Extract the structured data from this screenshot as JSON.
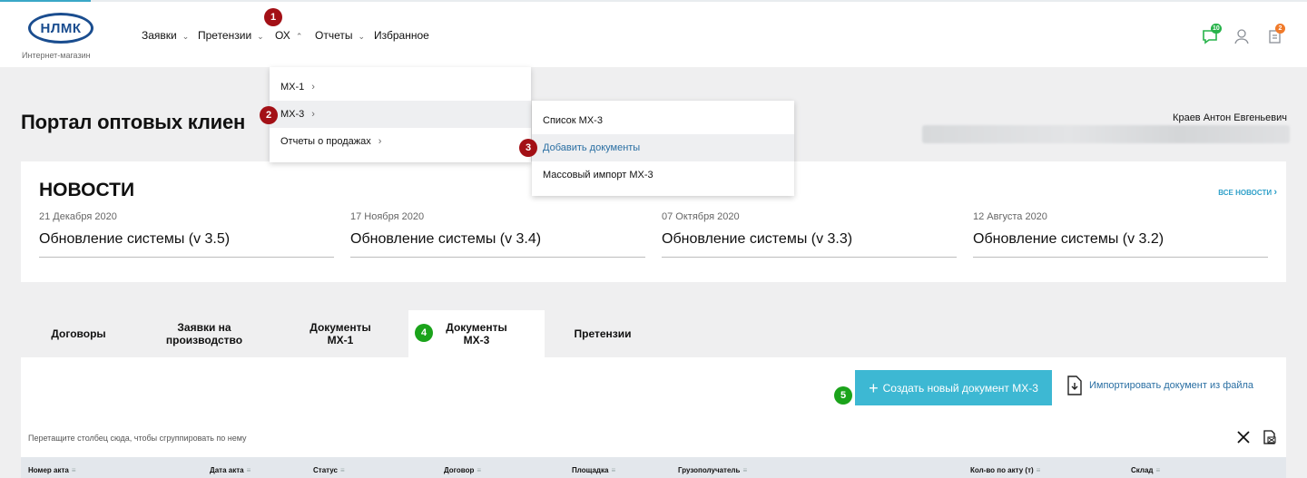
{
  "header": {
    "logo_text": "НЛМК",
    "logo_subtitle": "Интернет-магазин",
    "nav": [
      {
        "label": "Заявки",
        "chevron": "down"
      },
      {
        "label": "Претензии",
        "chevron": "down"
      },
      {
        "label": "ОХ",
        "chevron": "up"
      },
      {
        "label": "Отчеты",
        "chevron": "down"
      },
      {
        "label": "Избранное"
      }
    ],
    "icons": [
      {
        "name": "chat-icon",
        "badge": "10",
        "badge_color": "#27b34a"
      },
      {
        "name": "user-icon"
      },
      {
        "name": "cart-icon",
        "badge": "2",
        "badge_color": "#f07a2a"
      }
    ]
  },
  "menu": {
    "level1": [
      {
        "label": "МХ-1"
      },
      {
        "label": "МХ-3"
      },
      {
        "label": "Отчеты о продажах"
      }
    ],
    "level2": [
      {
        "label": "Список МХ-3"
      },
      {
        "label": "Добавить документы"
      },
      {
        "label": "Массовый импорт МХ-3"
      }
    ]
  },
  "steps": [
    "1",
    "2",
    "3",
    "4",
    "5"
  ],
  "page": {
    "title": "Портал оптовых клиен",
    "user_name": "Краев Антон Евгеньевич"
  },
  "news": {
    "title": "НОВОСТИ",
    "all_link": "ВСЕ НОВОСТИ",
    "items": [
      {
        "date": "21 Декабря 2020",
        "headline": "Обновление системы (v 3.5)"
      },
      {
        "date": "17 Ноября 2020",
        "headline": "Обновление системы (v 3.4)"
      },
      {
        "date": "07 Октября 2020",
        "headline": "Обновление системы (v 3.3)"
      },
      {
        "date": "12 Августа 2020",
        "headline": "Обновление системы (v 3.2)"
      }
    ]
  },
  "tabs": [
    {
      "label": "Договоры"
    },
    {
      "label": "Заявки на производство"
    },
    {
      "label": "Документы МХ-1"
    },
    {
      "label": "Документы МХ-3",
      "active": true
    },
    {
      "label": "Претензии"
    }
  ],
  "actions": {
    "create": "Создать новый документ МХ-3",
    "import": "Импортировать документ из файла"
  },
  "grid": {
    "group_hint": "Перетащите столбец сюда, чтобы сгруппировать по нему",
    "columns": [
      "Номер акта",
      "Дата акта",
      "Статус",
      "Договор",
      "Площадка",
      "Грузополучатель",
      "Кол-во по акту (т)",
      "Склад"
    ]
  },
  "colors": {
    "accent": "#3db8d3",
    "brand": "#1a4d8f",
    "step_red": "#a31016",
    "step_green": "#1ba31b"
  }
}
